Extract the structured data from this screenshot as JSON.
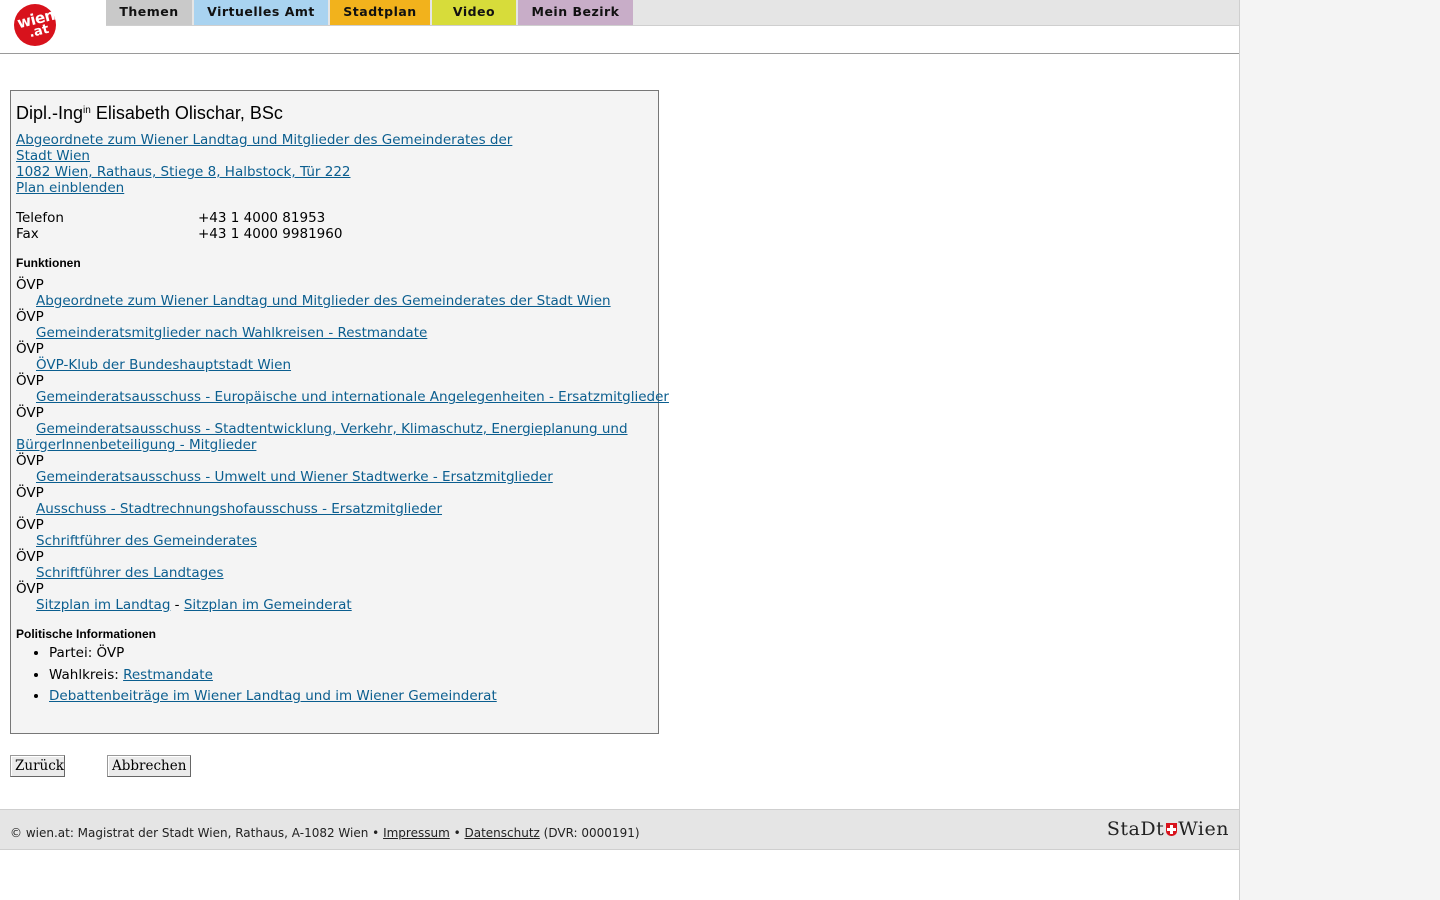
{
  "logo": {
    "line1": "wien",
    "line2": ".at"
  },
  "nav": {
    "tabs": [
      {
        "label": "Themen",
        "color": "#c9c9c9"
      },
      {
        "label": "Virtuelles Amt",
        "color": "#a9d3f0"
      },
      {
        "label": "Stadtplan",
        "color": "#f2b21c"
      },
      {
        "label": "Video",
        "color": "#d7dc3a"
      },
      {
        "label": "Mein Bezirk",
        "color": "#c8adc8"
      }
    ]
  },
  "person": {
    "title_prefix": "Dipl.-Ing",
    "title_sup": "in",
    "name": " Elisabeth Olischar, BSc",
    "org_line1": "Abgeordnete zum Wiener Landtag und Mitglieder des Gemeinderates der",
    "org_line2": "Stadt Wien ",
    "address": "1082 Wien, Rathaus, Stiege 8, Halbstock, Tür 222",
    "plan_link": "Plan einblenden",
    "phone_label": "Telefon",
    "phone": "+43 1 4000 81953",
    "fax_label": "Fax",
    "fax": "+43 1 4000 9981960"
  },
  "functions": {
    "heading": "Funktionen",
    "party": "ÖVP",
    "items": [
      "Abgeordnete zum Wiener Landtag und Mitglieder des Gemeinderates der Stadt Wien",
      "Gemeinderatsmitglieder nach Wahlkreisen - Restmandate",
      "ÖVP-Klub der Bundeshauptstadt Wien",
      "Gemeinderatsausschuss - Europäische und internationale Angelegenheiten - Ersatzmitglieder",
      "Gemeinderatsausschuss - Stadtentwicklung, Verkehr, Klimaschutz, Energieplanung und",
      "BürgerInnenbeteiligung - Mitglieder",
      "Gemeinderatsausschuss - Umwelt und Wiener Stadtwerke - Ersatzmitglieder",
      "Ausschuss - Stadtrechnungshofausschuss - Ersatzmitglieder",
      "Schriftführer des Gemeinderates",
      "Schriftführer des Landtages"
    ],
    "seat_landtag": "Sitzplan im Landtag",
    "seat_sep": " - ",
    "seat_gemeinderat": "Sitzplan im Gemeinderat"
  },
  "political": {
    "heading": "Politische Informationen",
    "party_label": "Partei: ",
    "party_value": "ÖVP",
    "district_label": "Wahlkreis: ",
    "district_value": "Restmandate",
    "debates": "Debattenbeiträge im Wiener Landtag und im Wiener Gemeinderat"
  },
  "buttons": {
    "back": "Zurück",
    "cancel": "Abbrechen"
  },
  "footer": {
    "text": "© wien.at: Magistrat der Stadt Wien, Rathaus, A-1082 Wien • ",
    "impressum": "Impressum",
    "bullet": " • ",
    "datenschutz": "Datenschutz",
    "dvr": " (DVR: 0000191)",
    "brand_left": "StaDt",
    "brand_right": "Wien"
  }
}
